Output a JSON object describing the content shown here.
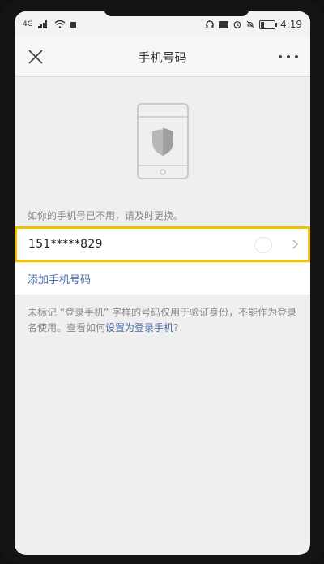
{
  "status_bar": {
    "left_small": "4G",
    "time": "4:19"
  },
  "header": {
    "title": "手机号码"
  },
  "hint": "如你的手机号已不用，请及时更换。",
  "phone_row": {
    "number": "151*****829"
  },
  "add_phone_label": "添加手机号码",
  "note": {
    "part1": "未标记 “登录手机” 字样的号码仅用于验证身份，不能作为登录名使用。查看如何",
    "link": "设置为登录手机",
    "part2": "?"
  },
  "colors": {
    "accent": "#f2c200",
    "link": "#4a6ea8",
    "background": "#efefef"
  }
}
